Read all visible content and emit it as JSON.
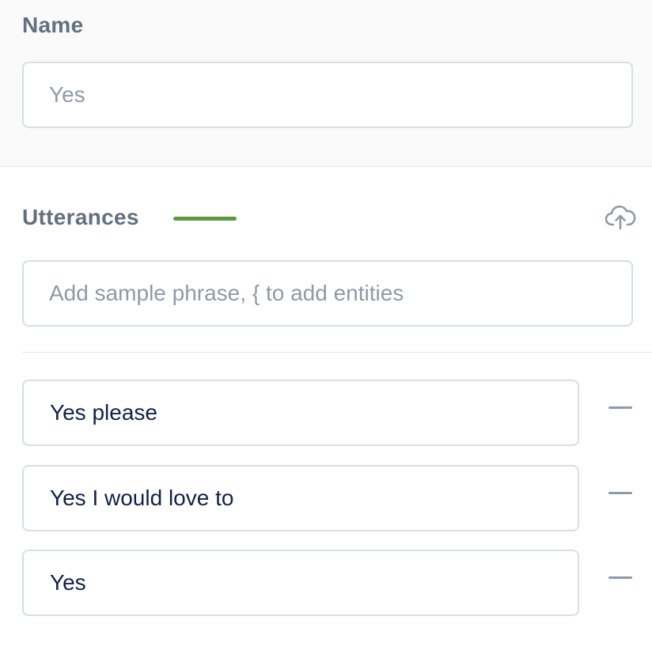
{
  "name_section": {
    "label": "Name",
    "input_placeholder": "Yes",
    "input_value": ""
  },
  "utterances_section": {
    "label": "Utterances",
    "accent_color": "#5b9a3e",
    "upload_icon": "cloud-upload-icon",
    "sample_placeholder": "Add sample phrase, { to add entities",
    "items": [
      {
        "text": "Yes please",
        "remove_icon": "minus-icon"
      },
      {
        "text": "Yes I would love to",
        "remove_icon": "minus-icon"
      },
      {
        "text": "Yes",
        "remove_icon": "minus-icon"
      }
    ]
  }
}
